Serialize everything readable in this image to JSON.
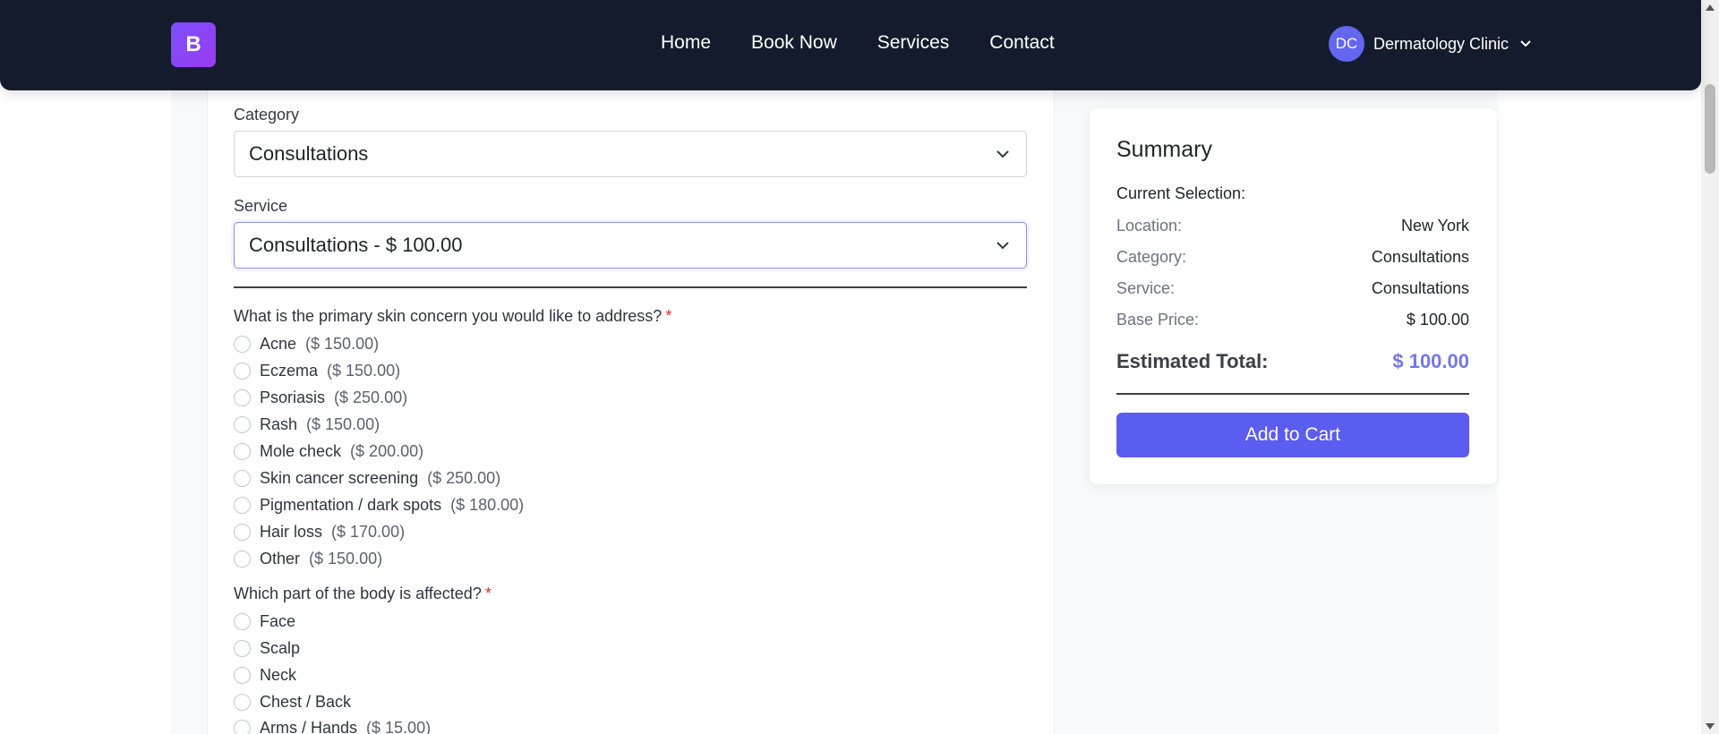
{
  "navbar": {
    "brand_letter": "B",
    "links": [
      "Home",
      "Book Now",
      "Services",
      "Contact"
    ],
    "user": {
      "initials": "DC",
      "name": "Dermatology Clinic"
    }
  },
  "form": {
    "category": {
      "label": "Category",
      "value": "Consultations"
    },
    "service": {
      "label": "Service",
      "value": "Consultations - $ 100.00"
    },
    "q1": {
      "text": "What is the primary skin concern you would like to address?",
      "required_mark": "*",
      "options": [
        {
          "label": "Acne",
          "price": "($ 150.00)"
        },
        {
          "label": "Eczema",
          "price": "($ 150.00)"
        },
        {
          "label": "Psoriasis",
          "price": "($ 250.00)"
        },
        {
          "label": "Rash",
          "price": "($ 150.00)"
        },
        {
          "label": "Mole check",
          "price": "($ 200.00)"
        },
        {
          "label": "Skin cancer screening",
          "price": "($ 250.00)"
        },
        {
          "label": "Pigmentation / dark spots",
          "price": "($ 180.00)"
        },
        {
          "label": "Hair loss",
          "price": "($ 170.00)"
        },
        {
          "label": "Other",
          "price": "($ 150.00)"
        }
      ]
    },
    "q2": {
      "text": "Which part of the body is affected?",
      "required_mark": "*",
      "options": [
        {
          "label": "Face",
          "price": ""
        },
        {
          "label": "Scalp",
          "price": ""
        },
        {
          "label": "Neck",
          "price": ""
        },
        {
          "label": "Chest / Back",
          "price": ""
        },
        {
          "label": "Arms / Hands",
          "price": "($ 15.00)"
        }
      ]
    }
  },
  "summary": {
    "title": "Summary",
    "current_selection": "Current Selection:",
    "rows": [
      {
        "key": "Location:",
        "value": "New York"
      },
      {
        "key": "Category:",
        "value": "Consultations"
      },
      {
        "key": "Service:",
        "value": "Consultations"
      },
      {
        "key": "Base Price:",
        "value": "$ 100.00"
      }
    ],
    "total_label": "Estimated Total:",
    "total_value": "$ 100.00",
    "add_button": "Add to Cart"
  },
  "colors": {
    "navbar_bg": "#141b2c",
    "accent": "#5b5cf0",
    "total_color": "#7178e8",
    "required": "#e03131"
  }
}
